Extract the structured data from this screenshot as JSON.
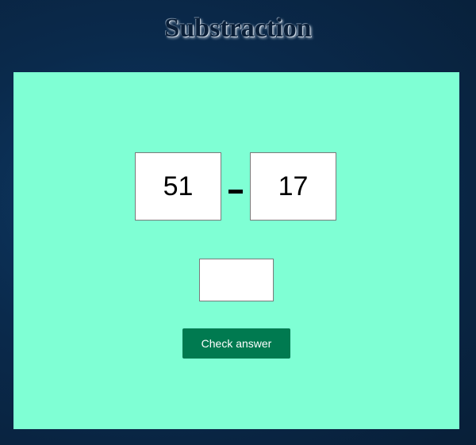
{
  "page": {
    "title": "Substraction"
  },
  "problem": {
    "operand_a": "51",
    "operator": "-",
    "operand_b": "17"
  },
  "answer": {
    "value": "",
    "placeholder": ""
  },
  "check_button": {
    "label": "Check answer"
  },
  "colors": {
    "background": "#0a2a4c",
    "panel": "#7fffd4",
    "button": "#007a50",
    "button_text": "#ffffff"
  }
}
